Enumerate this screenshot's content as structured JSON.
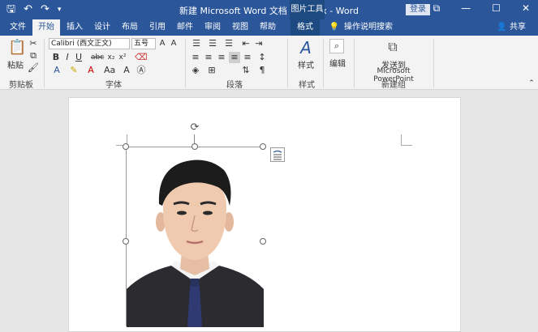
{
  "window": {
    "title": "新建 Microsoft Word 文档 (8).docx  -  Word",
    "picture_tools": "图片工具",
    "signin": "登录"
  },
  "tabs": [
    {
      "label": "文件"
    },
    {
      "label": "开始"
    },
    {
      "label": "插入"
    },
    {
      "label": "设计"
    },
    {
      "label": "布局"
    },
    {
      "label": "引用"
    },
    {
      "label": "邮件"
    },
    {
      "label": "审阅"
    },
    {
      "label": "视图"
    },
    {
      "label": "帮助"
    },
    {
      "label": "格式"
    }
  ],
  "tell_me": "操作说明搜索",
  "share": "共享",
  "ribbon": {
    "clipboard": {
      "paste": "粘贴",
      "label": "剪贴板"
    },
    "font": {
      "name": "Calibri (西文正文)",
      "size": "五号",
      "label": "字体"
    },
    "paragraph": {
      "label": "段落"
    },
    "styles": {
      "button": "样式",
      "label": "样式"
    },
    "editing": {
      "button": "编辑"
    },
    "newgroup": {
      "button_line1": "发送到",
      "button_line2": "Microsoft PowerPoint",
      "label": "新建组"
    }
  }
}
